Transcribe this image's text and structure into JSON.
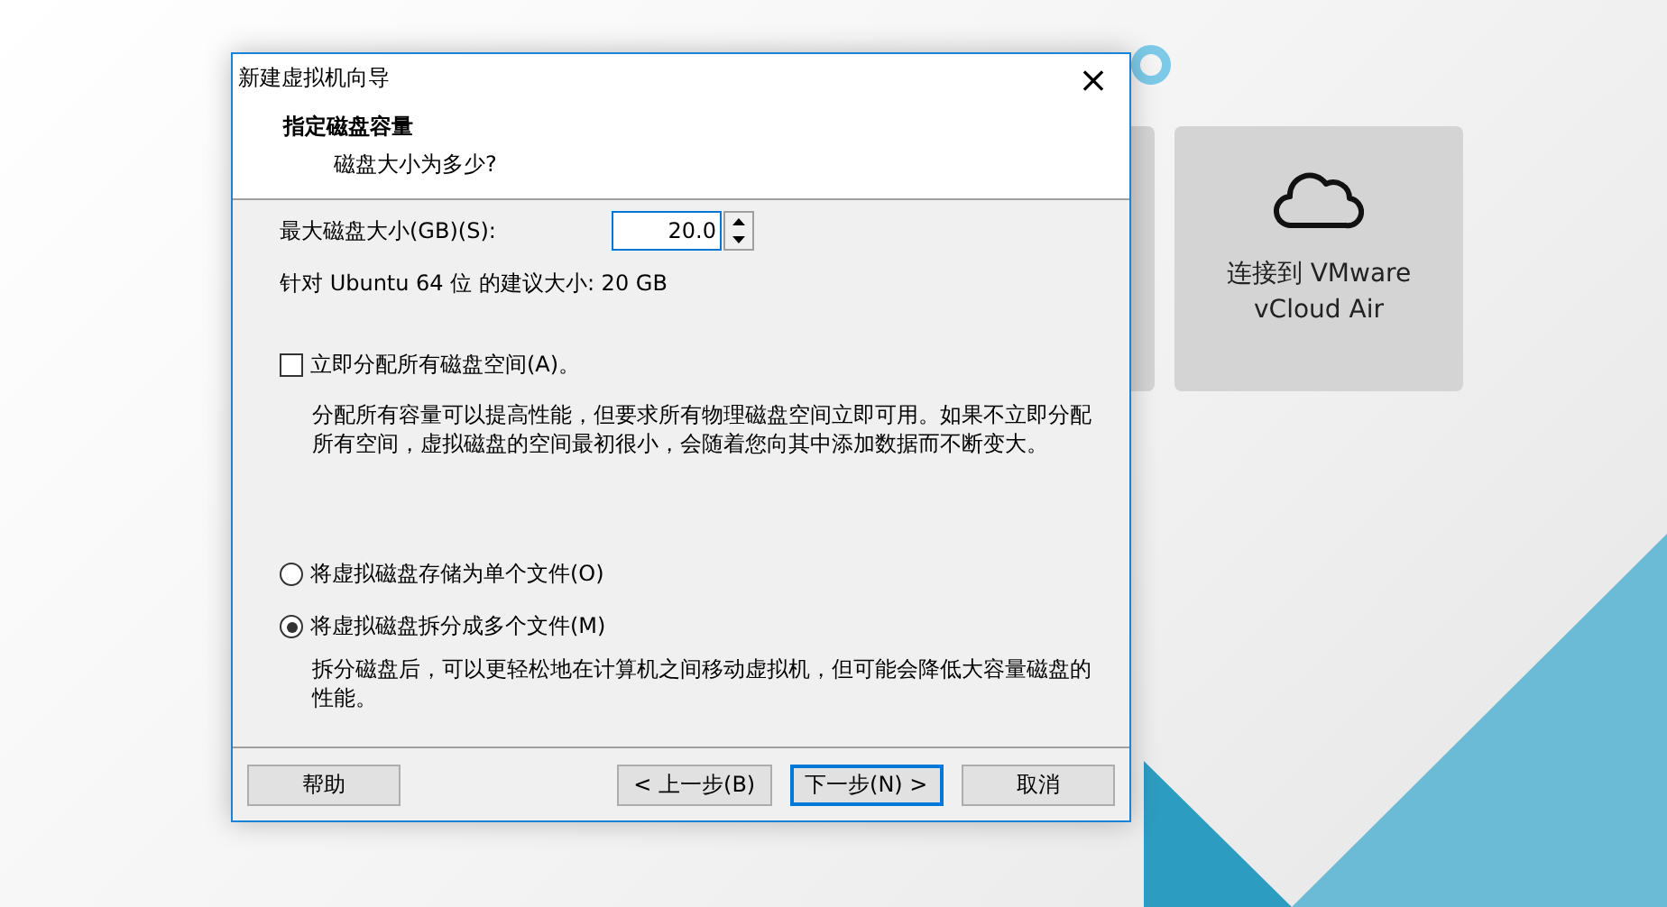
{
  "background": {
    "cards": [
      {
        "label": "连接到 VMware vCloud Air"
      }
    ]
  },
  "dialog": {
    "title": "新建虚拟机向导",
    "close": "×",
    "header": {
      "title": "指定磁盘容量",
      "subtitle": "磁盘大小为多少?"
    },
    "size_field": {
      "label": "最大磁盘大小(GB)(S):",
      "value": "20.0"
    },
    "recommendation": "针对 Ubuntu 64 位 的建议大小: 20 GB",
    "allocate": {
      "label": "立即分配所有磁盘空间(A)。",
      "checked": false,
      "description": "分配所有容量可以提高性能，但要求所有物理磁盘空间立即可用。如果不立即分配所有空间，虚拟磁盘的空间最初很小，会随着您向其中添加数据而不断变大。"
    },
    "storage_options": [
      {
        "label": "将虚拟磁盘存储为单个文件(O)",
        "selected": false
      },
      {
        "label": "将虚拟磁盘拆分成多个文件(M)",
        "selected": true,
        "description": "拆分磁盘后，可以更轻松地在计算机之间移动虚拟机，但可能会降低大容量磁盘的性能。"
      }
    ],
    "buttons": [
      {
        "label": "帮助",
        "kind": "help",
        "default": false
      },
      {
        "label": "< 上一步(B)",
        "kind": "nav",
        "default": false
      },
      {
        "label": "下一步(N) >",
        "kind": "nav",
        "default": true
      },
      {
        "label": "取消",
        "kind": "nav",
        "default": false
      }
    ]
  }
}
